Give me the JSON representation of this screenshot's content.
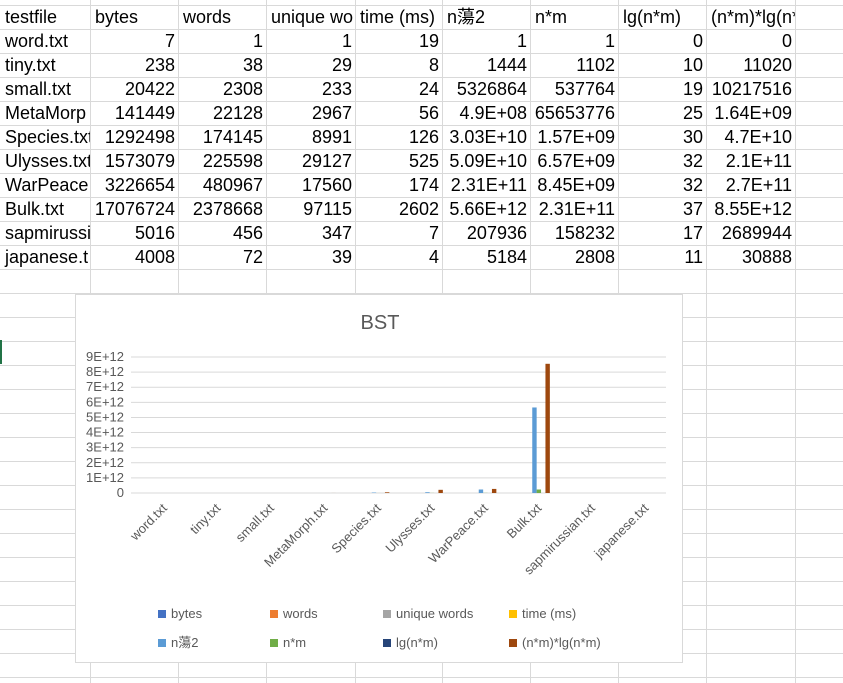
{
  "sheet": {
    "headers": [
      "testfile",
      "bytes",
      "words",
      "unique wo",
      "time (ms)",
      "n蕩2",
      "n*m",
      "lg(n*m)",
      "(n*m)*lg(n*m)"
    ],
    "rows": [
      [
        "word.txt",
        "7",
        "1",
        "1",
        "19",
        "1",
        "1",
        "0",
        "0"
      ],
      [
        "tiny.txt",
        "238",
        "38",
        "29",
        "8",
        "1444",
        "1102",
        "10",
        "11020"
      ],
      [
        "small.txt",
        "20422",
        "2308",
        "233",
        "24",
        "5326864",
        "537764",
        "19",
        "10217516"
      ],
      [
        "MetaMorp",
        "141449",
        "22128",
        "2967",
        "56",
        "4.9E+08",
        "65653776",
        "25",
        "1.64E+09"
      ],
      [
        "Species.txt",
        "1292498",
        "174145",
        "8991",
        "126",
        "3.03E+10",
        "1.57E+09",
        "30",
        "4.7E+10"
      ],
      [
        "Ulysses.txt",
        "1573079",
        "225598",
        "29127",
        "525",
        "5.09E+10",
        "6.57E+09",
        "32",
        "2.1E+11"
      ],
      [
        "WarPeace.",
        "3226654",
        "480967",
        "17560",
        "174",
        "2.31E+11",
        "8.45E+09",
        "32",
        "2.7E+11"
      ],
      [
        "Bulk.txt",
        "17076724",
        "2378668",
        "97115",
        "2602",
        "5.66E+12",
        "2.31E+11",
        "37",
        "8.55E+12"
      ],
      [
        "sapmirussi",
        "5016",
        "456",
        "347",
        "7",
        "207936",
        "158232",
        "17",
        "2689944"
      ],
      [
        "japanese.t",
        "4008",
        "72",
        "39",
        "4",
        "5184",
        "2808",
        "11",
        "30888"
      ]
    ]
  },
  "chart_data": {
    "type": "bar",
    "title": "BST",
    "categories": [
      "word.txt",
      "tiny.txt",
      "small.txt",
      "MetaMorph.txt",
      "Species.txt",
      "Ulysses.txt",
      "WarPeace.txt",
      "Bulk.txt",
      "sapmirussian.txt",
      "japanese.txt"
    ],
    "series": [
      {
        "name": "bytes",
        "color": "#4472C4",
        "values": [
          7,
          238,
          20422,
          141449,
          1292498,
          1573079,
          3226654,
          17076724,
          5016,
          4008
        ]
      },
      {
        "name": "words",
        "color": "#ED7D31",
        "values": [
          1,
          38,
          2308,
          22128,
          174145,
          225598,
          480967,
          2378668,
          456,
          72
        ]
      },
      {
        "name": "unique words",
        "color": "#A5A5A5",
        "values": [
          1,
          29,
          233,
          2967,
          8991,
          29127,
          17560,
          97115,
          347,
          39
        ]
      },
      {
        "name": "time (ms)",
        "color": "#FFC000",
        "values": [
          19,
          8,
          24,
          56,
          126,
          525,
          174,
          2602,
          7,
          4
        ]
      },
      {
        "name": "n蕩2",
        "color": "#5B9BD5",
        "values": [
          1,
          1444,
          5326864,
          490000000,
          30300000000,
          50900000000,
          231000000000,
          5660000000000,
          207936,
          5184
        ]
      },
      {
        "name": "n*m",
        "color": "#70AD47",
        "values": [
          1,
          1102,
          537764,
          65653776,
          1570000000,
          6570000000,
          8450000000,
          231000000000,
          158232,
          2808
        ]
      },
      {
        "name": "lg(n*m)",
        "color": "#264478",
        "values": [
          0,
          10,
          19,
          25,
          30,
          32,
          32,
          37,
          17,
          11
        ]
      },
      {
        "name": "(n*m)*lg(n*m)",
        "color": "#9E480E",
        "values": [
          0,
          11020,
          10217516,
          1640000000,
          47000000000,
          210000000000,
          270000000000,
          8550000000000,
          2689944,
          30888
        ]
      }
    ],
    "y_ticks": [
      "0",
      "1E+12",
      "2E+12",
      "3E+12",
      "4E+12",
      "5E+12",
      "6E+12",
      "7E+12",
      "8E+12",
      "9E+12"
    ],
    "ylim": [
      0,
      9000000000000
    ],
    "grid": true,
    "legend": "bottom"
  }
}
